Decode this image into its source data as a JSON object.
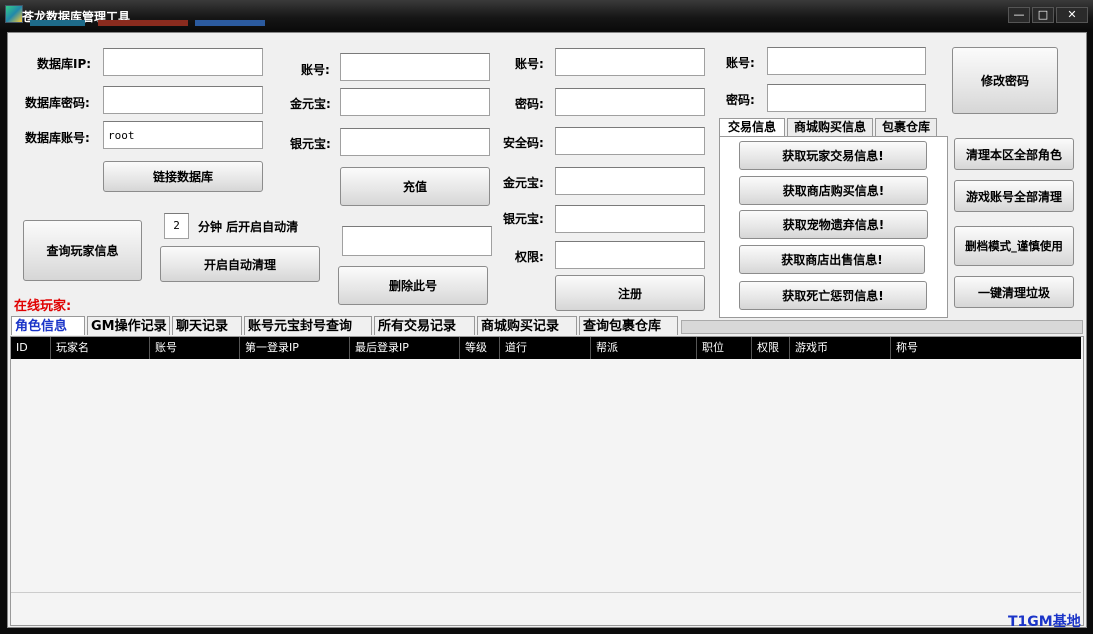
{
  "window": {
    "title": "苍龙数据库管理工具",
    "minimize_glyph": "—",
    "maximize_glyph": "□",
    "close_glyph": "✕"
  },
  "db": {
    "ip_label": "数据库IP:",
    "ip_value": "",
    "pwd_label": "数据库密码:",
    "pwd_value": "",
    "account_label": "数据库账号:",
    "account_value": "root",
    "connect_btn": "链接数据库"
  },
  "recharge": {
    "account_label": "账号:",
    "account_value": "",
    "gold_label": "金元宝:",
    "gold_value": "",
    "silver_label": "银元宝:",
    "silver_value": "",
    "recharge_btn": "充值",
    "delete_value": "",
    "delete_btn": "删除此号"
  },
  "register": {
    "account_label": "账号:",
    "password_label": "密码:",
    "security_label": "安全码:",
    "gold_label": "金元宝:",
    "silver_label": "银元宝:",
    "permission_label": "权限:",
    "register_btn": "注册"
  },
  "change_pwd": {
    "account_label": "账号:",
    "password_label": "密码:",
    "change_btn": "修改密码"
  },
  "auto_clean": {
    "query_btn": "查询玩家信息",
    "minutes_value": "2",
    "minutes_label": "分钟 后开启自动清",
    "start_btn": "开启自动清理"
  },
  "info_tabs": {
    "tabs": [
      "交易信息",
      "商城购买信息",
      "包裹仓库"
    ],
    "buttons": [
      "获取玩家交易信息!",
      "获取商店购买信息!",
      "获取宠物遗弃信息!",
      "获取商店出售信息!",
      "获取死亡惩罚信息!"
    ]
  },
  "right_buttons": [
    "清理本区全部角色",
    "游戏账号全部清理",
    "删档模式_谨慎使用",
    "一键清理垃圾"
  ],
  "online_label": "在线玩家:",
  "main_tabs": [
    "角色信息",
    "GM操作记录",
    "聊天记录",
    "账号元宝封号查询",
    "所有交易记录",
    "商城购买记录",
    "查询包裹仓库"
  ],
  "table": {
    "columns": [
      "ID",
      "玩家名",
      "账号",
      "第一登录IP",
      "最后登录IP",
      "等级",
      "道行",
      "帮派",
      "职位",
      "权限",
      "游戏币",
      "称号"
    ],
    "rows": []
  },
  "watermark": "T1GM基地",
  "colors": {
    "online_label": "#e00000",
    "active_tab": "#1a34c8",
    "watermark": "#1a34c8"
  }
}
